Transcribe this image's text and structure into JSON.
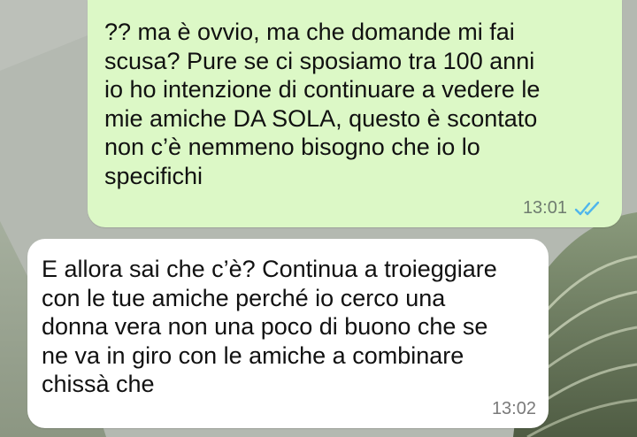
{
  "chat": {
    "messages": [
      {
        "direction": "outgoing",
        "text": "?? ma è ovvio, ma che domande mi fai\nscusa? Pure se ci sposiamo tra 100 anni\nio ho intenzione di continuare a vedere le\nmie amiche DA SOLA, questo è scontato\nnon c’è nemmeno bisogno che io lo\nspecifichi",
        "time": "13:01",
        "status_icon": "double-check-read-icon"
      },
      {
        "direction": "incoming",
        "text": "E allora sai che c’è? Continua a troieggiare\ncon le tue amiche perché io cerco una\ndonna vera non una poco di buono che se\nne va in giro con le amiche a combinare\nchissà che",
        "time": "13:02"
      }
    ]
  },
  "colors": {
    "outgoing_bubble": "#dcf8c6",
    "incoming_bubble": "#ffffff",
    "read_ticks": "#4fb6ec",
    "timestamp": "#6f7c70"
  }
}
